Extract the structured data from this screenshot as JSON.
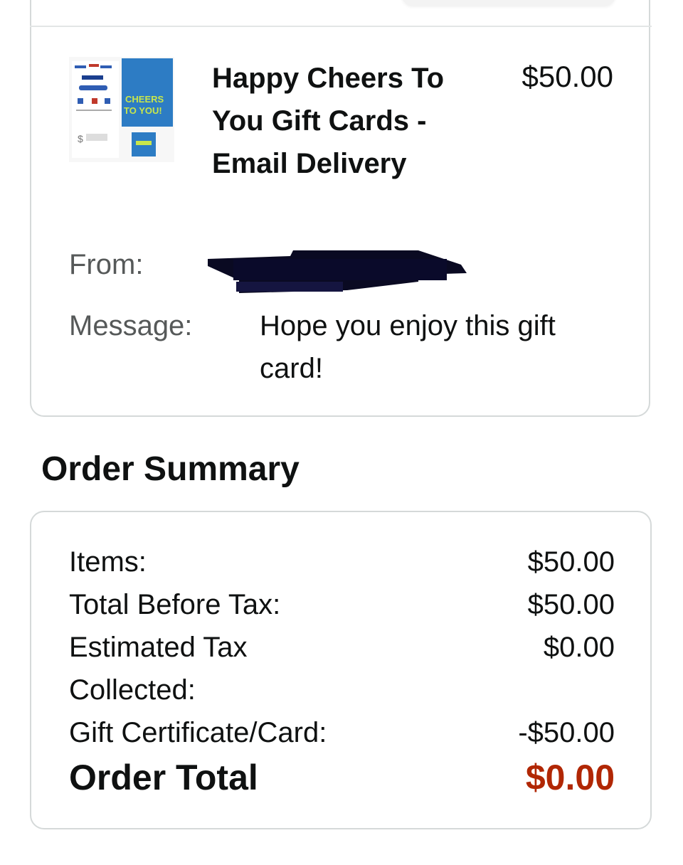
{
  "item": {
    "title": "Happy Cheers To You Gift Cards - Email Delivery",
    "price": "$50.00",
    "from_label": "From:",
    "message_label": "Message:",
    "message": "Hope you enjoy this gift card!",
    "thumbnail_icon": "gift-card-thumbnail-icon"
  },
  "summary": {
    "title": "Order Summary",
    "rows": [
      {
        "label": "Items:",
        "value": "$50.00"
      },
      {
        "label": "Total Before Tax:",
        "value": "$50.00"
      },
      {
        "label": "Estimated Tax Collected:",
        "value": "$0.00"
      },
      {
        "label": "Gift Certificate/Card:",
        "value": "-$50.00"
      }
    ],
    "total_label": "Order Total",
    "total_value": "$0.00"
  },
  "colors": {
    "total_accent": "#b12704",
    "border": "#d5d9d9",
    "muted_text": "#565959"
  }
}
